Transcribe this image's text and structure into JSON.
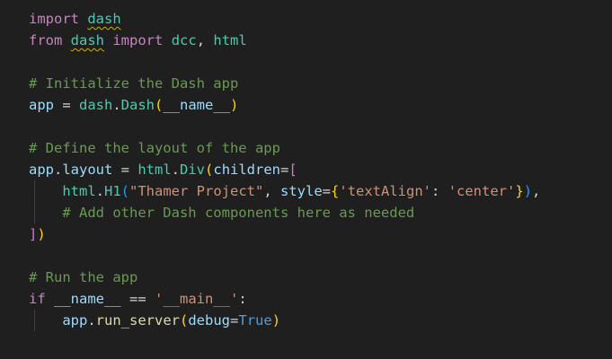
{
  "colors": {
    "background": "#1f1f1f",
    "keyword": "#c586c0",
    "blue_keyword": "#569cd6",
    "variable": "#9cdcfe",
    "class_type": "#4ec9b0",
    "function": "#dcdcaa",
    "string": "#ce9178",
    "comment": "#6a9955",
    "punctuation": "#d4d4d4",
    "bracket_gold": "#ffd700",
    "bracket_pink": "#da70d6",
    "bracket_blue": "#179fff"
  },
  "code": {
    "lines": [
      {
        "tokens": [
          {
            "text": "import",
            "color": "keyword"
          },
          {
            "text": " ",
            "color": "punctuation"
          },
          {
            "text": "dash",
            "color": "class_type",
            "squiggle": true
          }
        ]
      },
      {
        "tokens": [
          {
            "text": "from",
            "color": "keyword"
          },
          {
            "text": " ",
            "color": "punctuation"
          },
          {
            "text": "dash",
            "color": "class_type",
            "squiggle": true
          },
          {
            "text": " ",
            "color": "punctuation"
          },
          {
            "text": "import",
            "color": "keyword"
          },
          {
            "text": " ",
            "color": "punctuation"
          },
          {
            "text": "dcc",
            "color": "class_type"
          },
          {
            "text": ", ",
            "color": "punctuation"
          },
          {
            "text": "html",
            "color": "class_type"
          }
        ]
      },
      {
        "tokens": []
      },
      {
        "tokens": [
          {
            "text": "# Initialize the Dash app",
            "color": "comment"
          }
        ]
      },
      {
        "tokens": [
          {
            "text": "app",
            "color": "variable"
          },
          {
            "text": " = ",
            "color": "punctuation"
          },
          {
            "text": "dash",
            "color": "class_type"
          },
          {
            "text": ".",
            "color": "punctuation"
          },
          {
            "text": "Dash",
            "color": "class_type"
          },
          {
            "text": "(",
            "color": "bracket_gold"
          },
          {
            "text": "__name__",
            "color": "variable"
          },
          {
            "text": ")",
            "color": "bracket_gold"
          }
        ]
      },
      {
        "tokens": []
      },
      {
        "tokens": [
          {
            "text": "# Define the layout of the app",
            "color": "comment"
          }
        ]
      },
      {
        "tokens": [
          {
            "text": "app",
            "color": "variable"
          },
          {
            "text": ".",
            "color": "punctuation"
          },
          {
            "text": "layout",
            "color": "variable"
          },
          {
            "text": " = ",
            "color": "punctuation"
          },
          {
            "text": "html",
            "color": "class_type"
          },
          {
            "text": ".",
            "color": "punctuation"
          },
          {
            "text": "Div",
            "color": "class_type"
          },
          {
            "text": "(",
            "color": "bracket_gold"
          },
          {
            "text": "children",
            "color": "variable"
          },
          {
            "text": "=",
            "color": "punctuation"
          },
          {
            "text": "[",
            "color": "bracket_pink"
          }
        ]
      },
      {
        "tokens": [
          {
            "text": "    ",
            "color": "punctuation"
          },
          {
            "text": "html",
            "color": "class_type"
          },
          {
            "text": ".",
            "color": "punctuation"
          },
          {
            "text": "H1",
            "color": "class_type"
          },
          {
            "text": "(",
            "color": "bracket_blue"
          },
          {
            "text": "\"Thamer Project\"",
            "color": "string"
          },
          {
            "text": ", ",
            "color": "punctuation"
          },
          {
            "text": "style",
            "color": "variable"
          },
          {
            "text": "=",
            "color": "punctuation"
          },
          {
            "text": "{",
            "color": "bracket_gold"
          },
          {
            "text": "'textAlign'",
            "color": "string"
          },
          {
            "text": ": ",
            "color": "punctuation"
          },
          {
            "text": "'center'",
            "color": "string"
          },
          {
            "text": "}",
            "color": "bracket_gold"
          },
          {
            "text": ")",
            "color": "bracket_blue"
          },
          {
            "text": ",",
            "color": "punctuation"
          }
        ]
      },
      {
        "tokens": [
          {
            "text": "    ",
            "color": "punctuation"
          },
          {
            "text": "# Add other Dash components here as needed",
            "color": "comment"
          }
        ]
      },
      {
        "tokens": [
          {
            "text": "]",
            "color": "bracket_pink"
          },
          {
            "text": ")",
            "color": "bracket_gold"
          }
        ]
      },
      {
        "tokens": []
      },
      {
        "tokens": [
          {
            "text": "# Run the app",
            "color": "comment"
          }
        ]
      },
      {
        "tokens": [
          {
            "text": "if",
            "color": "keyword"
          },
          {
            "text": " ",
            "color": "punctuation"
          },
          {
            "text": "__name__",
            "color": "variable"
          },
          {
            "text": " == ",
            "color": "punctuation"
          },
          {
            "text": "'__main__'",
            "color": "string"
          },
          {
            "text": ":",
            "color": "punctuation"
          }
        ]
      },
      {
        "tokens": [
          {
            "text": "    ",
            "color": "punctuation"
          },
          {
            "text": "app",
            "color": "variable"
          },
          {
            "text": ".",
            "color": "punctuation"
          },
          {
            "text": "run_server",
            "color": "function"
          },
          {
            "text": "(",
            "color": "bracket_gold"
          },
          {
            "text": "debug",
            "color": "variable"
          },
          {
            "text": "=",
            "color": "punctuation"
          },
          {
            "text": "True",
            "color": "blue_keyword"
          },
          {
            "text": ")",
            "color": "bracket_gold"
          }
        ]
      }
    ]
  }
}
